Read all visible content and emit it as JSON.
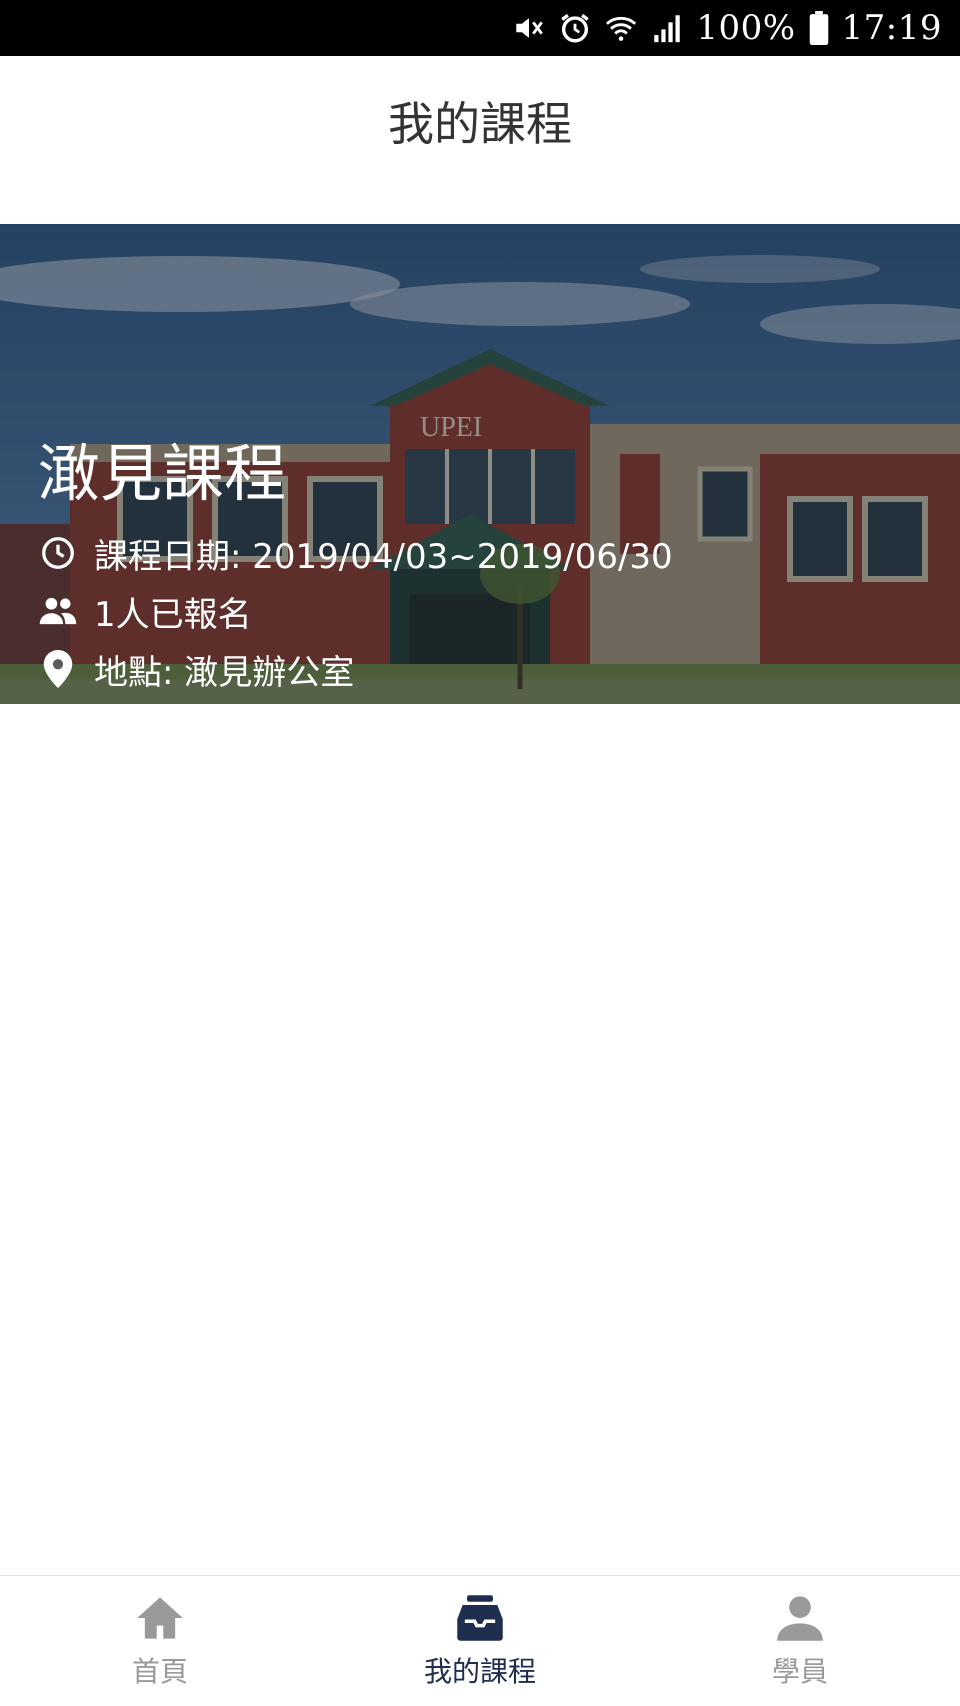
{
  "status_bar": {
    "battery": "100%",
    "time": "17:19",
    "icons": [
      "mute-icon",
      "alarm-icon",
      "wifi-icon",
      "signal-icon",
      "battery-icon"
    ]
  },
  "header": {
    "title": "我的課程"
  },
  "course": {
    "name": "澉見課程",
    "date_text": "課程日期: 2019/04/03~2019/06/30",
    "enrolled_text": "1人已報名",
    "location_text": "地點: 澉見辦公室",
    "image_sign_text": "UPEI",
    "icons": [
      "clock-icon",
      "people-icon",
      "location-pin-icon"
    ]
  },
  "bottom_nav": {
    "items": [
      {
        "label": "首頁",
        "icon": "home-icon",
        "active": false
      },
      {
        "label": "我的課程",
        "icon": "inbox-icon",
        "active": true
      },
      {
        "label": "學員",
        "icon": "person-icon",
        "active": false
      }
    ]
  },
  "colors": {
    "active": "#1f2d4f",
    "inactive": "#9a9a9a",
    "title": "#333333",
    "status_bar_bg": "#000000"
  }
}
